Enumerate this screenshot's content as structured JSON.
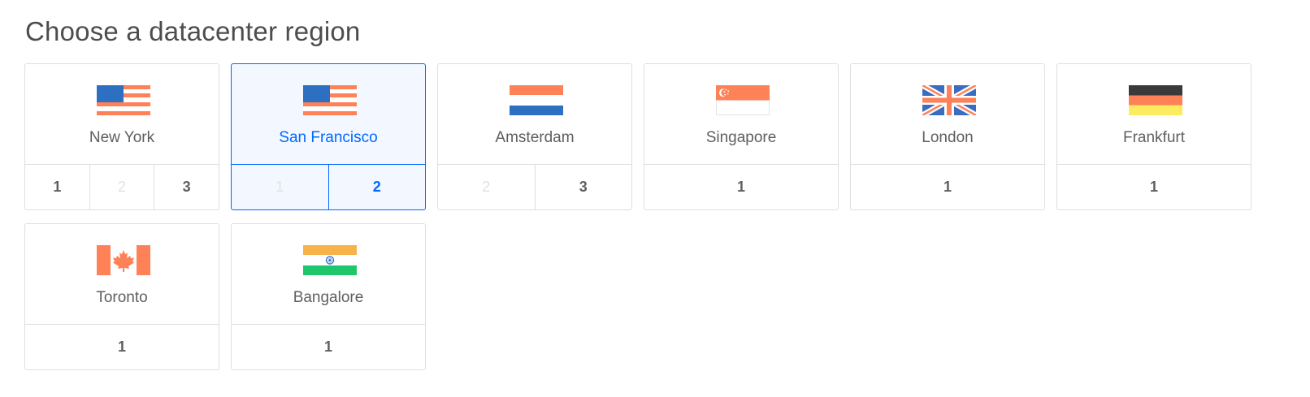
{
  "title": "Choose a datacenter region",
  "colors": {
    "accent": "#0069ff",
    "border": "#dfdfdf",
    "selected_bg": "#f3f7ff"
  },
  "regions": [
    {
      "name": "New York",
      "flag_icon": "usa-flag-icon",
      "selected": false,
      "numbers": [
        {
          "label": "1",
          "state": "normal"
        },
        {
          "label": "2",
          "state": "disabled"
        },
        {
          "label": "3",
          "state": "normal"
        }
      ]
    },
    {
      "name": "San Francisco",
      "flag_icon": "usa-flag-icon",
      "selected": true,
      "numbers": [
        {
          "label": "1",
          "state": "disabled"
        },
        {
          "label": "2",
          "state": "active"
        }
      ]
    },
    {
      "name": "Amsterdam",
      "flag_icon": "netherlands-flag-icon",
      "selected": false,
      "numbers": [
        {
          "label": "2",
          "state": "disabled"
        },
        {
          "label": "3",
          "state": "normal"
        }
      ]
    },
    {
      "name": "Singapore",
      "flag_icon": "singapore-flag-icon",
      "selected": false,
      "numbers": [
        {
          "label": "1",
          "state": "normal"
        }
      ]
    },
    {
      "name": "London",
      "flag_icon": "uk-flag-icon",
      "selected": false,
      "numbers": [
        {
          "label": "1",
          "state": "normal"
        }
      ]
    },
    {
      "name": "Frankfurt",
      "flag_icon": "germany-flag-icon",
      "selected": false,
      "numbers": [
        {
          "label": "1",
          "state": "normal"
        }
      ]
    },
    {
      "name": "Toronto",
      "flag_icon": "canada-flag-icon",
      "selected": false,
      "numbers": [
        {
          "label": "1",
          "state": "normal"
        }
      ]
    },
    {
      "name": "Bangalore",
      "flag_icon": "india-flag-icon",
      "selected": false,
      "numbers": [
        {
          "label": "1",
          "state": "normal"
        }
      ]
    }
  ]
}
